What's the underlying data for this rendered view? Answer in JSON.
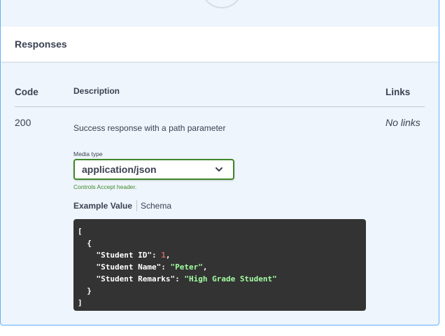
{
  "section": {
    "title": "Responses"
  },
  "table": {
    "headers": {
      "code": "Code",
      "description": "Description",
      "links": "Links"
    },
    "rows": [
      {
        "code": "200",
        "description": "Success response with a path parameter",
        "links": "No links"
      }
    ]
  },
  "media": {
    "label": "Media type",
    "selected": "application/json",
    "note": "Controls Accept header."
  },
  "tabs": {
    "example": "Example Value",
    "schema": "Schema"
  },
  "example_json": {
    "open_bracket": "[",
    "open_brace": "{",
    "fields": [
      {
        "key": "\"Student ID\"",
        "sep": ": ",
        "value": "1",
        "trail": ",",
        "type": "number"
      },
      {
        "key": "\"Student Name\"",
        "sep": ": ",
        "value": "\"Peter\"",
        "trail": ",",
        "type": "string"
      },
      {
        "key": "\"Student Remarks\"",
        "sep": ": ",
        "value": "\"High Grade Student\"",
        "trail": "",
        "type": "string"
      }
    ],
    "close_brace": "}",
    "close_bracket": "]"
  },
  "colors": {
    "border_accent": "#61affe",
    "success_green": "#41862a",
    "code_bg": "#333333",
    "code_number": "#d36363",
    "code_string": "#a2fca2"
  }
}
